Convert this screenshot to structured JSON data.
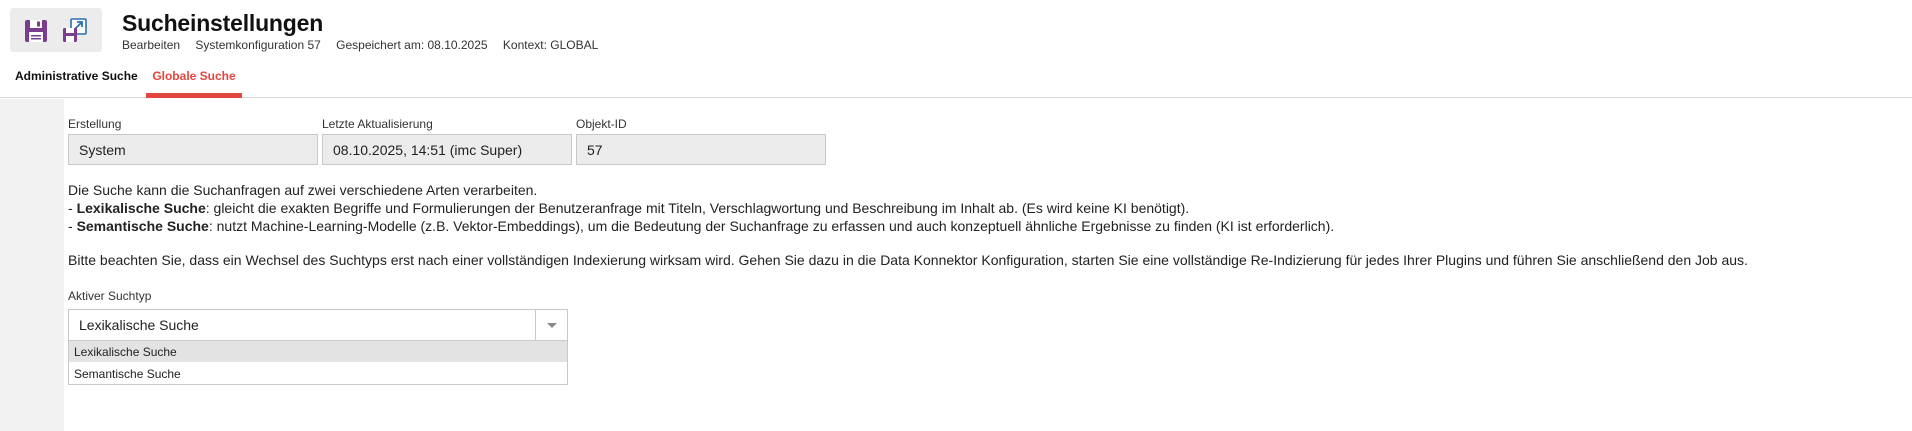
{
  "header": {
    "title": "Sucheinstellungen",
    "meta": {
      "mode": "Bearbeiten",
      "config": "Systemkonfiguration 57",
      "saved": "Gespeichert am: 08.10.2025",
      "context": "Kontext: GLOBAL"
    },
    "icons": [
      "save-icon",
      "save-as-icon"
    ]
  },
  "tabs": [
    {
      "label": "Administrative Suche",
      "active": false
    },
    {
      "label": "Globale Suche",
      "active": true
    }
  ],
  "fields": {
    "creation": {
      "label": "Erstellung",
      "value": "System"
    },
    "last_update": {
      "label": "Letzte Aktualisierung",
      "value": "08.10.2025, 14:51 (imc Super)"
    },
    "object_id": {
      "label": "Objekt-ID",
      "value": "57"
    }
  },
  "description": {
    "intro": "Die Suche kann die Suchanfragen auf zwei verschiedene Arten verarbeiten.",
    "lexical_term": "Lexikalische Suche",
    "lexical_text": ": gleicht die exakten Begriffe und Formulierungen der Benutzeranfrage mit Titeln, Verschlagwortung und Beschreibung im Inhalt ab. (Es wird keine KI benötigt).",
    "semantic_term": "Semantische Suche",
    "semantic_text": ": nutzt Machine-Learning-Modelle (z.B. Vektor-Embeddings), um die Bedeutung der Suchanfrage zu erfassen und auch konzeptuell ähnliche Ergebnisse zu finden (KI ist erforderlich).",
    "note": "Bitte beachten Sie, dass ein Wechsel des Suchtyps erst nach einer vollständigen Indexierung wirksam wird. Gehen Sie dazu in die Data Konnektor Konfiguration, starten Sie eine vollständige Re-Indizierung für jedes Ihrer Plugins und führen Sie anschließend den Job aus."
  },
  "search_type": {
    "label": "Aktiver Suchtyp",
    "selected": "Lexikalische Suche",
    "options": [
      "Lexikalische Suche",
      "Semantische Suche"
    ]
  },
  "colors": {
    "accent": "#e2463f",
    "icon_purple": "#7a3d8f",
    "icon_blue": "#2a6fb0",
    "field_bg": "#ececec"
  }
}
